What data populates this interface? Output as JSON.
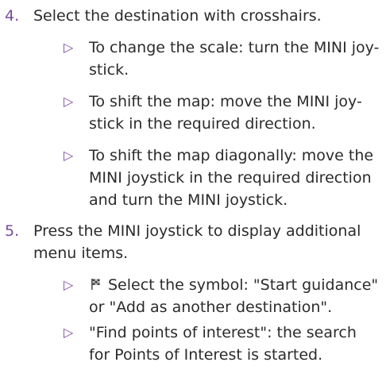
{
  "steps": [
    {
      "number": "4.",
      "text": "Select the destination with crosshairs.",
      "bullets": [
        {
          "mark": "▷",
          "text": "To change the scale: turn the MINI joy-stick."
        },
        {
          "mark": "▷",
          "text": "To shift the map: move the MINI joy-stick in the required direction."
        },
        {
          "mark": "▷",
          "text": "To shift the map diagonally: move the MINI joystick in the required direction and turn the MINI joystick."
        }
      ]
    },
    {
      "number": "5.",
      "text": "Press the MINI joystick to display additional menu items.",
      "bullets": [
        {
          "mark": "▷",
          "icon": "destination-flag-icon",
          "text": "Select the symbol: \"Start guidance\" or \"Add as another destination\"."
        },
        {
          "mark": "▷",
          "text": "\"Find points of interest\": the search for Points of Interest is started."
        }
      ]
    }
  ],
  "colors": {
    "accent": "#7a4aa0",
    "text": "#2b2b2b"
  }
}
